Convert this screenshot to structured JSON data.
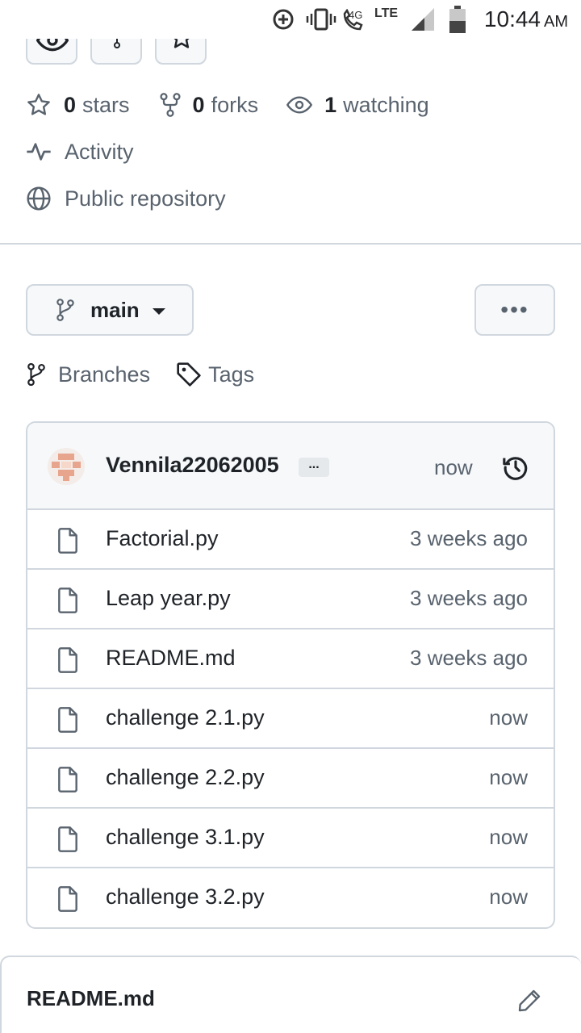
{
  "status_bar": {
    "network_4g": "4G",
    "network_lte": "LTE",
    "time": "10:44",
    "ampm": "AM"
  },
  "repo_stats": {
    "stars_count": "0",
    "stars_label": "stars",
    "forks_count": "0",
    "forks_label": "forks",
    "watching_count": "1",
    "watching_label": "watching"
  },
  "activity_label": "Activity",
  "visibility_label": "Public repository",
  "branch": {
    "current": "main",
    "more_label": "•••"
  },
  "links": {
    "branches": "Branches",
    "tags": "Tags"
  },
  "latest_commit": {
    "author": "Vennila22062005",
    "dots": "...",
    "time": "now"
  },
  "files": [
    {
      "name": "Factorial.py",
      "time": "3 weeks ago"
    },
    {
      "name": "Leap year.py",
      "time": "3 weeks ago"
    },
    {
      "name": "README.md",
      "time": "3 weeks ago"
    },
    {
      "name": "challenge 2.1.py",
      "time": "now"
    },
    {
      "name": "challenge 2.2.py",
      "time": "now"
    },
    {
      "name": "challenge 3.1.py",
      "time": "now"
    },
    {
      "name": "challenge 3.2.py",
      "time": "now"
    }
  ],
  "readme": {
    "title": "README.md"
  },
  "icons": [
    "data-saver-icon",
    "vibrate-icon",
    "wifi-calling-icon",
    "signal-icon",
    "battery-icon",
    "eye-icon",
    "fork-icon",
    "star-icon",
    "pulse-icon",
    "globe-icon",
    "git-branch-icon",
    "tag-icon",
    "history-icon",
    "file-icon",
    "pencil-icon"
  ]
}
